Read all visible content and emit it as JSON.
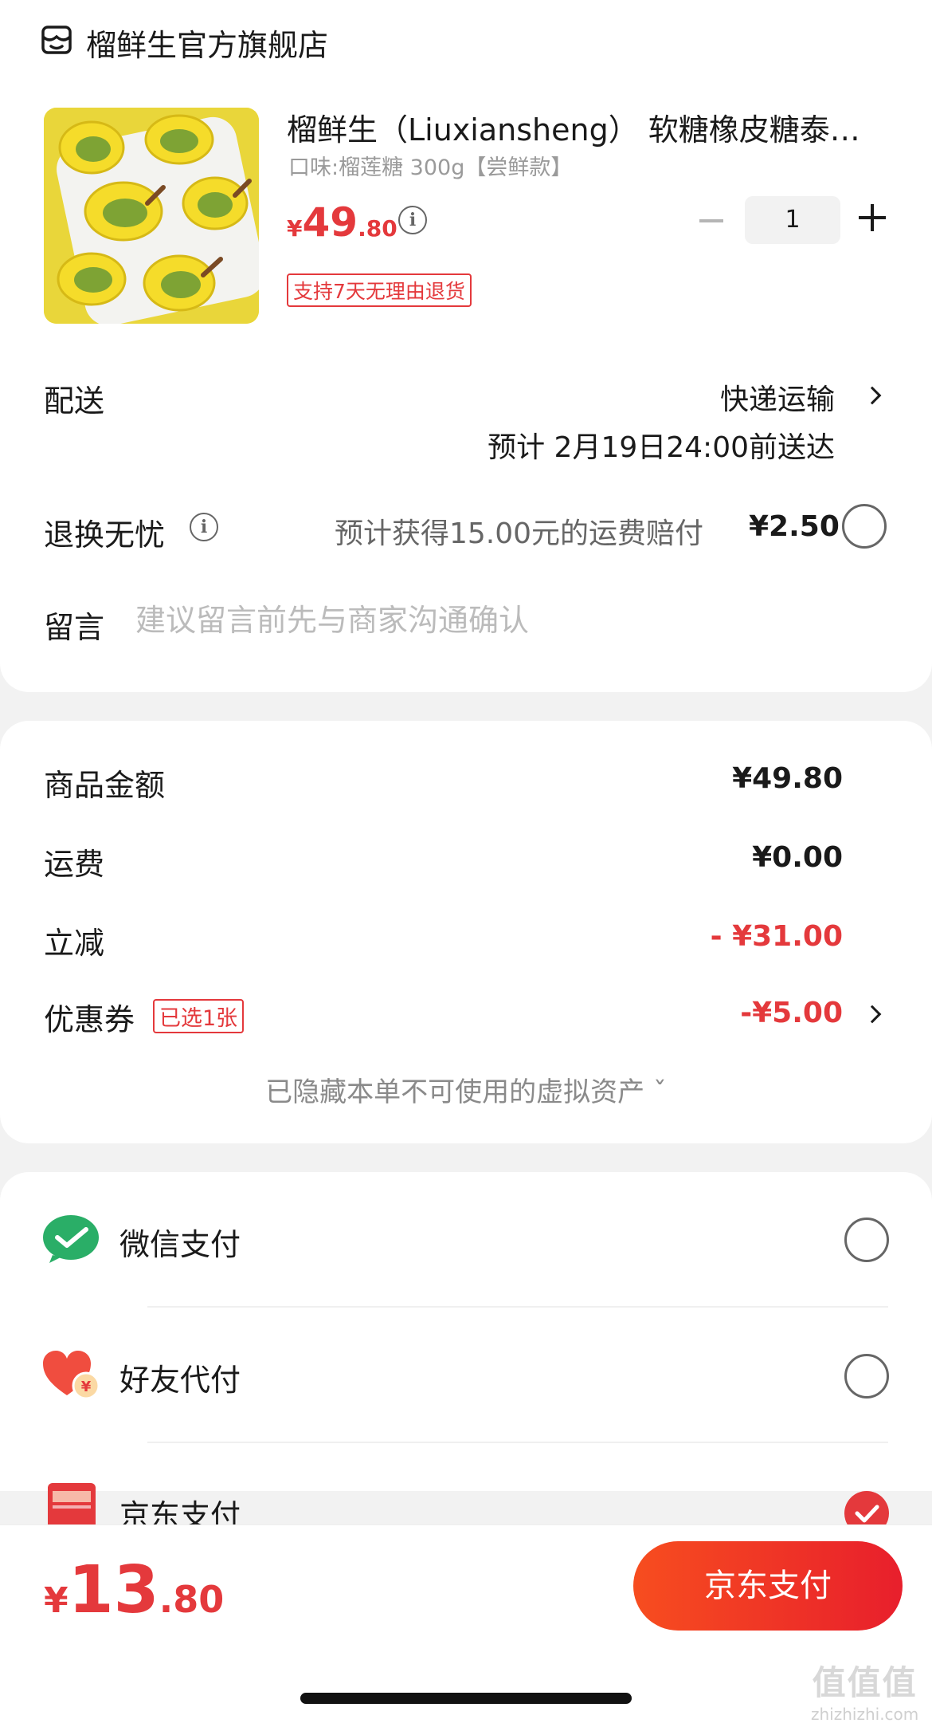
{
  "shop": {
    "name": "榴鲜生官方旗舰店",
    "icon": "shop-icon"
  },
  "product": {
    "title": "榴鲜生（Liuxiansheng） 软糖橡皮糖泰…",
    "spec": "口味:榴莲糖 300g【尝鲜款】",
    "price_currency": "¥",
    "price_int": "49",
    "price_dec": ".80",
    "return_tag": "支持7天无理由退货",
    "quantity": "1"
  },
  "delivery": {
    "label": "配送",
    "method": "快递运输",
    "eta": "预计 2月19日24:00前送达"
  },
  "refund": {
    "label": "退换无忧",
    "desc": "预计获得15.00元的运费赔付",
    "fee": "¥2.50"
  },
  "message": {
    "label": "留言",
    "placeholder": "建议留言前先与商家沟通确认"
  },
  "summary": {
    "goods_label": "商品金额",
    "goods_value": "¥49.80",
    "shipping_label": "运费",
    "shipping_value": "¥0.00",
    "discount_label": "立减",
    "discount_value": "- ¥31.00",
    "coupon_label": "优惠券",
    "coupon_tag": "已选1张",
    "coupon_value": "-¥5.00",
    "hidden_assets": "已隐藏本单不可使用的虚拟资产 ˇ"
  },
  "payment": {
    "wechat_label": "微信支付",
    "friend_label": "好友代付",
    "jd_label": "京东支付",
    "selected": "京东支付"
  },
  "bottom": {
    "total_currency": "¥",
    "total_int": "13",
    "total_dec": ".80",
    "pay_button": "京东支付"
  },
  "watermark": {
    "top": "值值值",
    "bottom": "zhizhizhi.com"
  },
  "colors": {
    "accent": "#e4393c",
    "button_start": "#f74d1f",
    "button_end": "#e81f2c",
    "wechat": "#2aae67"
  }
}
